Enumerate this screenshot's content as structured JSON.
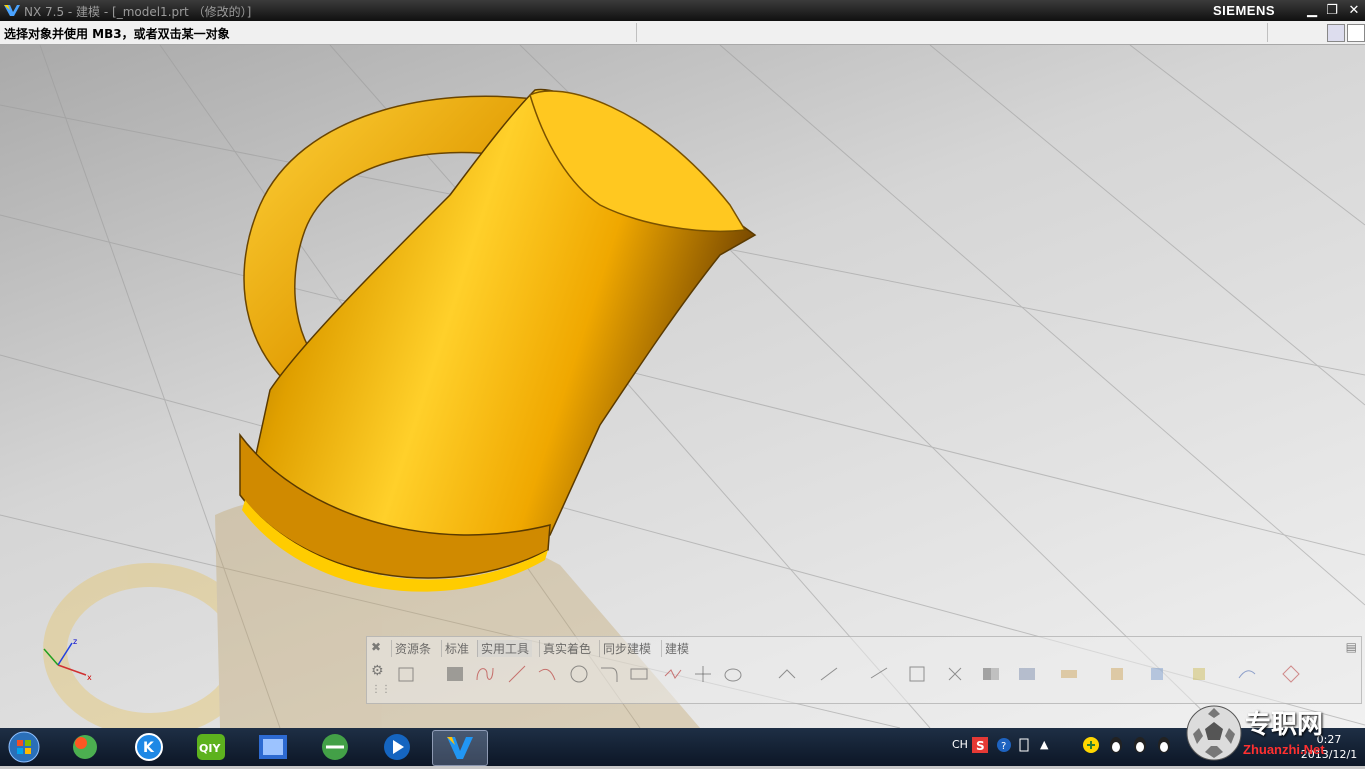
{
  "window": {
    "title": "NX 7.5 - 建模 - [_model1.prt （修改的）]",
    "brand": "SIEMENS"
  },
  "cue_line": {
    "text": "选择对象并使用 MB3，或者双击某一对象"
  },
  "viewport": {
    "model": "kettle",
    "model_color": "#f0b000",
    "triad_axes": [
      "X",
      "Y",
      "Z"
    ]
  },
  "floating_toolbar": {
    "tabs": [
      {
        "label": "资源条",
        "active": false
      },
      {
        "label": "标准",
        "active": false
      },
      {
        "label": "实用工具",
        "active": true
      },
      {
        "label": "真实着色",
        "active": false
      },
      {
        "label": "同步建模",
        "active": false
      },
      {
        "label": "建模",
        "active": false
      }
    ],
    "tools": [
      "sketch-icon",
      "rectangle-icon",
      "studio-spline-icon",
      "line-icon",
      "arc-icon",
      "circle-icon",
      "fillet-icon",
      "profile-icon",
      "point-icon",
      "extrude-icon",
      "revolve-icon",
      "hole-icon",
      "boss-icon",
      "pocket-icon",
      "pad-icon",
      "pattern-icon",
      "unite-icon",
      "blend-icon",
      "chamfer-icon",
      "shell-icon",
      "draft-icon",
      "offset-icon",
      "surface-icon",
      "mesh-icon"
    ]
  },
  "taskbar": {
    "apps": [
      "windows-start",
      "kde-app",
      "kugou-app",
      "iqiyi-app",
      "film-app",
      "browser-app",
      "media-player-app",
      "nx-app"
    ],
    "tray": {
      "lang": "CH"
    },
    "clock": {
      "time": "0:27",
      "date": "2013/12/1"
    }
  },
  "watermark": {
    "text": "专职网",
    "url": "Zhuanzhi.Net"
  }
}
